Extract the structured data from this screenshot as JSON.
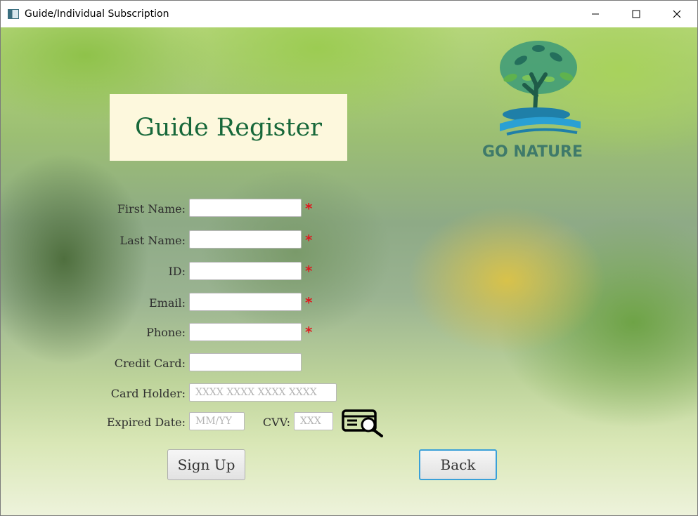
{
  "window": {
    "title": "Guide/Individual Subscription",
    "controls": {
      "minimize": "—",
      "maximize": "☐",
      "close": "✕"
    }
  },
  "header": {
    "title": "Guide Register"
  },
  "logo": {
    "text": "GO NATURE",
    "icon": "tree-logo-icon"
  },
  "form": {
    "first_name_label": "First Name:",
    "last_name_label": "Last Name:",
    "id_label": "ID:",
    "email_label": "Email:",
    "phone_label": "Phone:",
    "credit_card_label": "Credit Card:",
    "card_holder_label": "Card Holder:",
    "card_holder_placeholder": "XXXX XXXX XXXX XXXX",
    "expired_date_label": "Expired Date:",
    "expired_date_placeholder": "MM/YY",
    "cvv_label": "CVV:",
    "cvv_placeholder": "XXX",
    "required_marker": "*",
    "cvv_icon": "cvv-card-search-icon"
  },
  "buttons": {
    "sign_up": "Sign Up",
    "back": "Back"
  },
  "colors": {
    "title_green": "#17683a",
    "required_red": "#e0191f",
    "focus_blue": "#3aa0d8"
  }
}
